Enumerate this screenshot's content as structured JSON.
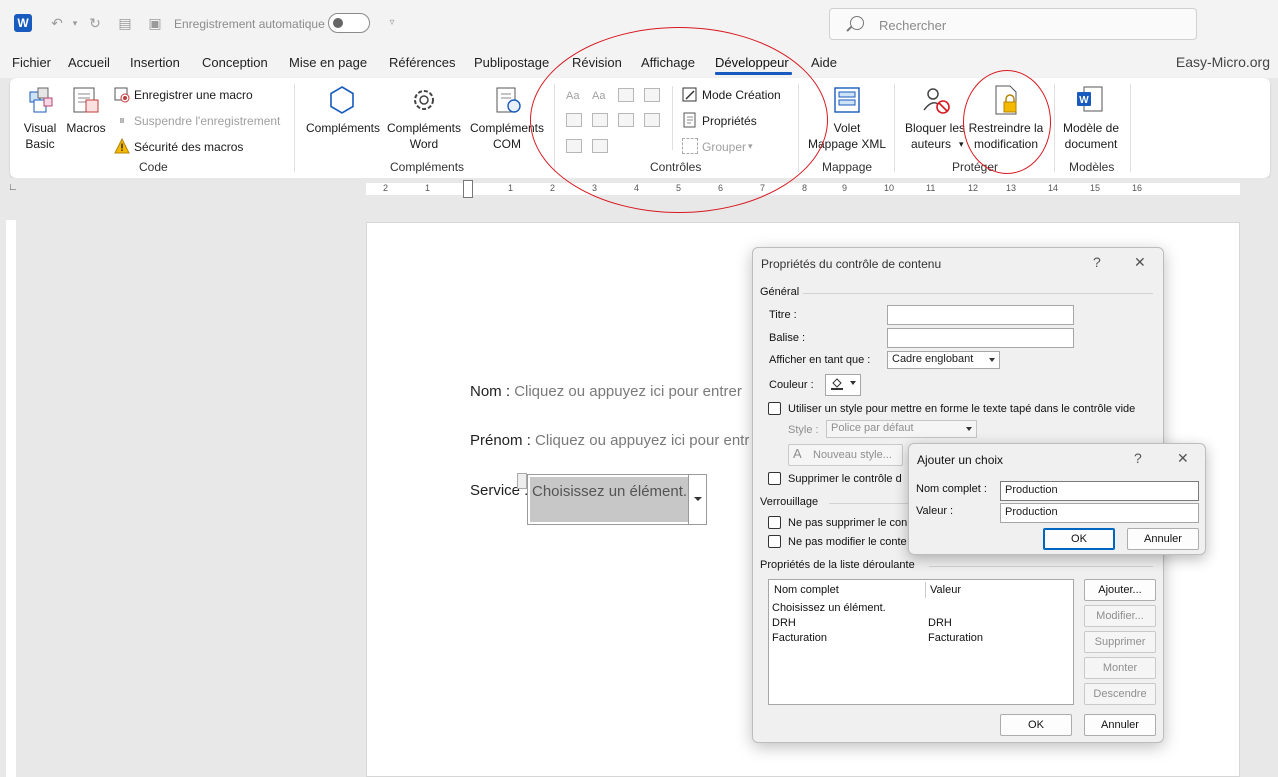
{
  "titlebar": {
    "autosave_label": "Enregistrement automatique",
    "search_placeholder": "Rechercher"
  },
  "menu": {
    "tabs": [
      "Fichier",
      "Accueil",
      "Insertion",
      "Conception",
      "Mise en page",
      "Références",
      "Publipostage",
      "Révision",
      "Affichage",
      "Développeur",
      "Aide"
    ],
    "active": "Développeur",
    "site": "Easy-Micro.org"
  },
  "ribbon": {
    "code": {
      "label": "Code",
      "visual_basic_1": "Visual",
      "visual_basic_2": "Basic",
      "macros": "Macros",
      "record_macro": "Enregistrer une macro",
      "pause_recording": "Suspendre l'enregistrement",
      "macro_security": "Sécurité des macros"
    },
    "addins": {
      "label": "Compléments",
      "addins": "Compléments",
      "word_addins_1": "Compléments",
      "word_addins_2": "Word",
      "com_addins_1": "Compléments",
      "com_addins_2": "COM"
    },
    "controls": {
      "label": "Contrôles",
      "design_mode": "Mode Création",
      "properties": "Propriétés",
      "group": "Grouper"
    },
    "mapping": {
      "label": "Mappage",
      "xml_pane_1": "Volet",
      "xml_pane_2": "Mappage XML"
    },
    "protect": {
      "label": "Protéger",
      "block_authors_1": "Bloquer les",
      "block_authors_2": "auteurs",
      "restrict_editing_1": "Restreindre la",
      "restrict_editing_2": "modification"
    },
    "templates": {
      "label": "Modèles",
      "document_template_1": "Modèle de",
      "document_template_2": "document"
    }
  },
  "ruler": {
    "numbers": [
      "1",
      "2",
      "1",
      "2",
      "3",
      "4",
      "5",
      "6",
      "7",
      "8",
      "9",
      "10",
      "11",
      "12",
      "13",
      "14",
      "15",
      "16"
    ]
  },
  "document": {
    "nom_label": "Nom : ",
    "nom_placeholder": "Cliquez ou appuyez ici pour entrer",
    "prenom_label": "Prénom : ",
    "prenom_placeholder": "Cliquez ou appuyez ici pour entr",
    "service_label": "Service : ",
    "service_value": "Choisissez un élément."
  },
  "props_dialog": {
    "title": "Propriétés du contrôle de contenu",
    "help": "?",
    "close": "✕",
    "general": "Général",
    "titre_label": "Titre :",
    "titre_value": "",
    "balise_label": "Balise :",
    "balise_value": "",
    "afficher_label": "Afficher en tant que :",
    "afficher_value": "Cadre englobant",
    "couleur_label": "Couleur :",
    "use_style_label": "Utiliser un style pour mettre en forme le texte tapé dans le contrôle vide",
    "style_label": "Style :",
    "style_value": "Police par défaut",
    "new_style": "Nouveau style...",
    "delete_control_label": "Supprimer le contrôle d",
    "locking": "Verrouillage",
    "no_delete_label": "Ne pas supprimer le con",
    "no_edit_label": "Ne pas modifier le conte",
    "dropdown_props": "Propriétés de la liste déroulante",
    "col_name": "Nom complet",
    "col_value": "Valeur",
    "rows": [
      {
        "name": "Choisissez un élément.",
        "value": ""
      },
      {
        "name": "DRH",
        "value": "DRH"
      },
      {
        "name": "Facturation",
        "value": "Facturation"
      }
    ],
    "add": "Ajouter...",
    "modify": "Modifier...",
    "delete": "Supprimer",
    "up": "Monter",
    "down": "Descendre",
    "ok": "OK",
    "cancel": "Annuler"
  },
  "add_dialog": {
    "title": "Ajouter un choix",
    "help": "?",
    "close": "✕",
    "name_label": "Nom complet :",
    "name_value": "Production",
    "value_label": "Valeur :",
    "value_value": "Production",
    "ok": "OK",
    "cancel": "Annuler"
  },
  "colors": {
    "accent": "#185abd",
    "annotation": "#d71920"
  }
}
